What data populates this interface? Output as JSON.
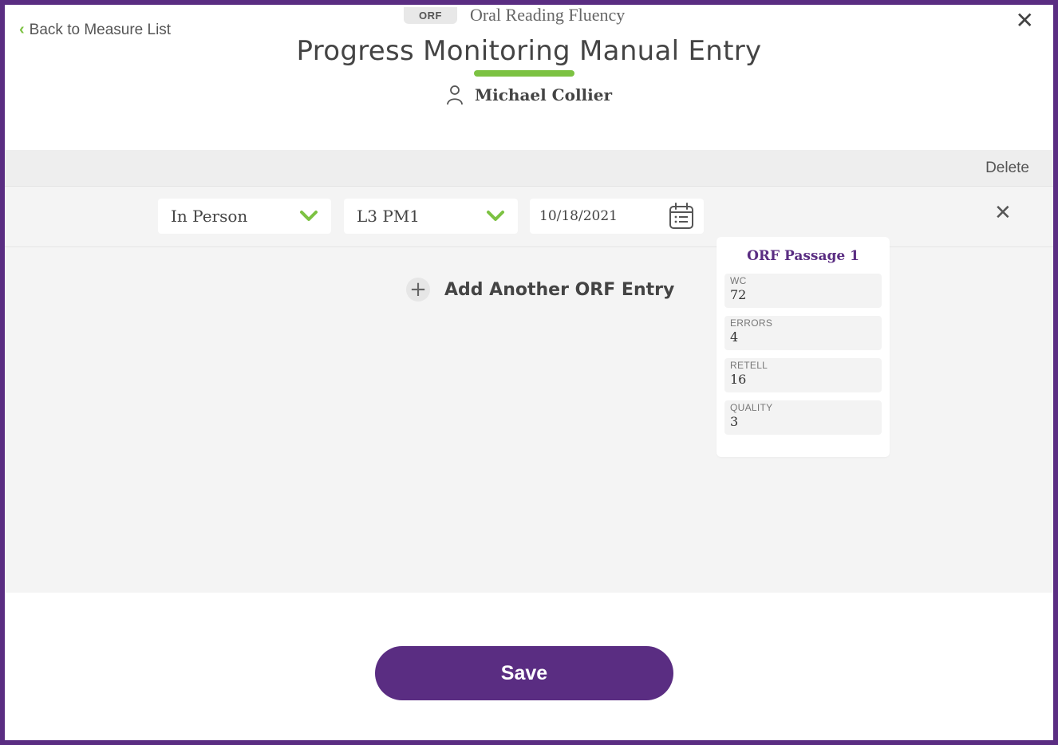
{
  "header": {
    "back_label": "Back to Measure List",
    "measure_badge": "ORF",
    "measure_name": "Oral Reading Fluency",
    "title": "Progress Monitoring Manual Entry",
    "student_name": "Michael Collier",
    "accent_color": "#7cc242",
    "brand_color": "#5a2d82"
  },
  "toolbar": {
    "delete_label": "Delete"
  },
  "entry": {
    "mode_value": "In Person",
    "passage_value": "L3 PM1",
    "date_value": "10/18/2021",
    "score_card": {
      "title": "ORF Passage 1",
      "fields": [
        {
          "label": "WC",
          "value": "72"
        },
        {
          "label": "ERRORS",
          "value": "4"
        },
        {
          "label": "RETELL",
          "value": "16"
        },
        {
          "label": "QUALITY",
          "value": "3"
        }
      ]
    }
  },
  "actions": {
    "add_entry_label": "Add Another ORF Entry",
    "save_label": "Save"
  },
  "icons": {
    "back": "chevron-left-icon",
    "close": "close-icon",
    "person": "person-icon",
    "dropdown": "chevron-down-icon",
    "calendar": "calendar-icon",
    "add": "plus-icon"
  }
}
